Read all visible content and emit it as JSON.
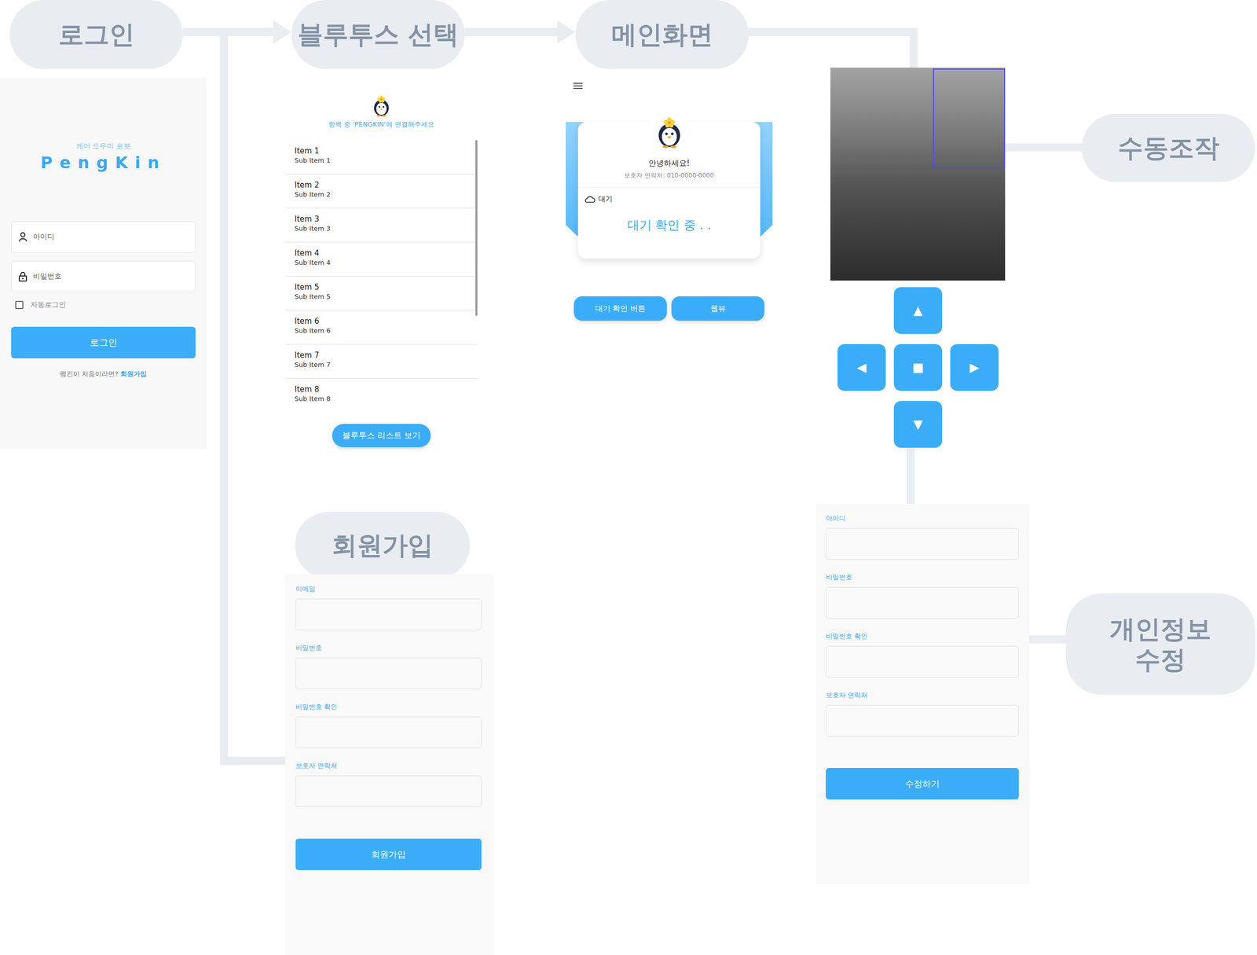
{
  "flow": [
    {
      "label": "로그인"
    },
    {
      "label": "블루투스 선택"
    },
    {
      "label": "메인화면"
    },
    {
      "label": "수동조작"
    },
    {
      "label": "회원가입"
    },
    {
      "label": "개인정보 수정"
    }
  ],
  "login": {
    "subtitle": "케어 도우미 로봇",
    "logo": "PengKin",
    "fields": [
      {
        "placeholder": "아이디",
        "kind": "user"
      },
      {
        "placeholder": "비밀번호",
        "kind": "lock"
      }
    ],
    "auto_login": {
      "label": "자동로그인",
      "checked": false
    },
    "button": "로그인",
    "signup_prompt": "펭킨이 처음이라면?",
    "signup_link": "회원가입"
  },
  "bluetooth": {
    "prompt": "항목 중 'PENGKIN'에 연결해주세요",
    "items": [
      {
        "title": "Item 1",
        "subtitle": "Sub Item 1"
      },
      {
        "title": "Item 2",
        "subtitle": "Sub Item 2"
      },
      {
        "title": "Item 3",
        "subtitle": "Sub Item 3"
      },
      {
        "title": "Item 4",
        "subtitle": "Sub Item 4"
      },
      {
        "title": "Item 5",
        "subtitle": "Sub Item 5"
      },
      {
        "title": "Item 6",
        "subtitle": "Sub Item 6"
      },
      {
        "title": "Item 7",
        "subtitle": "Sub Item 7"
      },
      {
        "title": "Item 8",
        "subtitle": "Sub Item 8"
      }
    ],
    "button": "블루투스 리스트 보기"
  },
  "main": {
    "greeting": "안녕하세요!",
    "contact": "보호자 연락처: 010-0000-0000",
    "status_label": "대기",
    "status_text": "대기 확인 중 . .",
    "buttons": [
      "대기 확인 버튼",
      "웹뷰"
    ]
  },
  "manual": {
    "controls": [
      "▲",
      "◀",
      "■",
      "▶",
      "▼"
    ]
  },
  "profile_edit": {
    "fields": [
      "아이디",
      "비밀번호",
      "비밀번호 확인",
      "보호자 연락처"
    ],
    "button": "수정하기"
  },
  "signup": {
    "fields": [
      "이메일",
      "비밀번호",
      "비밀번호 확인",
      "보호자 연락처"
    ],
    "button": "회원가입"
  }
}
